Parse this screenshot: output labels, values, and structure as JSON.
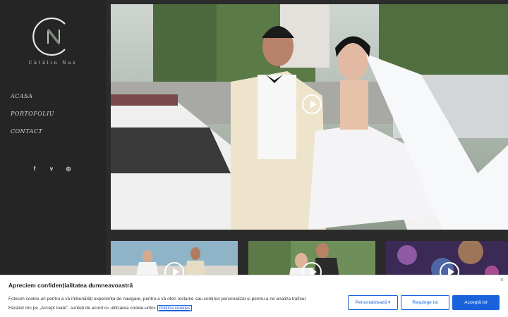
{
  "brand": {
    "logo_text": "Cătălin Naz"
  },
  "nav": {
    "items": [
      "ACASA",
      "PORTOFOLIU",
      "CONTACT"
    ]
  },
  "social": {
    "facebook": "f",
    "vimeo": "v",
    "instagram": "◎"
  },
  "cookie": {
    "title": "Apreciem confidențialitatea dumneavoastră",
    "text_line1": "Folosim cookie-uri pentru a vă îmbunătăți experiența de navigare, pentru a vă oferi reclame sau conținut personalizat și pentru a ne analiza traficul.",
    "text_line2": "Făcând clic pe „Accept toate”, sunteți de acord cu utilizarea cookie-urilor.",
    "policy_link": "Politica cookies",
    "customize_label": "Personalizează ▾",
    "reject_label": "Respinge tot",
    "accept_label": "Acceptă tot",
    "close_label": "×"
  },
  "colors": {
    "sidebar": "#252525",
    "accent": "#1863dc"
  }
}
